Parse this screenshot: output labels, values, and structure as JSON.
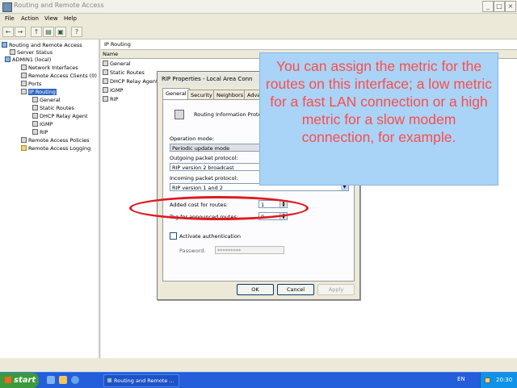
{
  "window": {
    "title": "Routing and Remote Access",
    "menu": [
      "File",
      "Action",
      "View",
      "Help"
    ],
    "toolbar_icons": [
      "back-icon",
      "forward-icon",
      "up-icon",
      "show-hide-tree-icon",
      "export-icon",
      "help-icon"
    ]
  },
  "tree": {
    "root": "Routing and Remote Access",
    "server_status": "Server Status",
    "server": "ADMIN1 (local)",
    "items": [
      "Network Interfaces",
      "Remote Access Clients (0)",
      "Ports",
      "IP Routing"
    ],
    "ip_routing_children": [
      "General",
      "Static Routes",
      "DHCP Relay Agent",
      "IGMP",
      "RIP"
    ],
    "remote_access_policies": "Remote Access Policies",
    "remote_access_logging": "Remote Access Logging"
  },
  "main": {
    "title": "IP Routing",
    "column_header": "Name",
    "rows": [
      "General",
      "Static Routes",
      "DHCP Relay Agent",
      "IGMP",
      "RIP"
    ]
  },
  "dialog": {
    "title": "RIP Properties - Local Area Conn",
    "tabs": [
      "General",
      "Security",
      "Neighbors",
      "Advar"
    ],
    "protocol_label": "Routing Information Protocol",
    "operation_mode_label": "Operation mode:",
    "operation_mode_value": "Periodic update mode",
    "outgoing_label": "Outgoing packet protocol:",
    "outgoing_value": "RIP version 2 broadcast",
    "incoming_label": "Incoming packet protocol:",
    "incoming_value": "RIP version 1 and 2",
    "added_cost_label": "Added cost for routes:",
    "added_cost_value": "1",
    "tag_label": "Tag for announced routes:",
    "tag_value": "0",
    "activate_auth_label": "Activate authentication",
    "password_label": "Password:",
    "password_value": "*********",
    "ok": "OK",
    "cancel": "Cancel",
    "apply": "Apply"
  },
  "callout": {
    "text": "You can assign the metric for the routes on this interface; a low metric for a fast LAN connection or a high metric for a slow modem connection, for example."
  },
  "taskbar": {
    "start": "start",
    "task": "Routing and Remote ...",
    "language": "EN",
    "clock": "20:30"
  },
  "colors": {
    "callout_bg": "#a9d4f7",
    "callout_text": "#ff4b4b",
    "highlight_ellipse": "#e0191f",
    "taskbar": "#245edb"
  }
}
